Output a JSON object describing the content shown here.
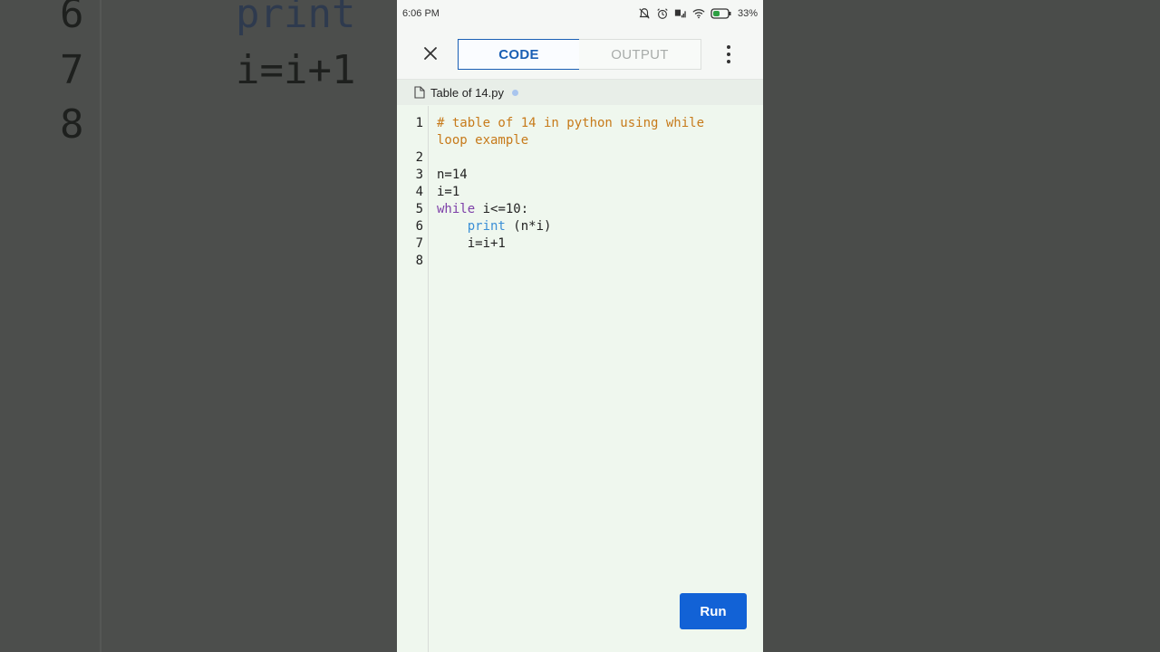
{
  "background": {
    "line_numbers": [
      "6",
      "7",
      "8"
    ],
    "code_lines": [
      "print",
      "i=i+1"
    ]
  },
  "status_bar": {
    "time": "6:06 PM",
    "battery": "33%"
  },
  "toolbar": {
    "code_tab": "CODE",
    "output_tab": "OUTPUT"
  },
  "file": {
    "name": "Table of 14.py"
  },
  "editor": {
    "line_numbers": [
      "1",
      "2",
      "3",
      "4",
      "5",
      "6",
      "7",
      "8"
    ],
    "lines": {
      "l1a": "# table of 14 in python using while",
      "l1b": "loop example",
      "l3": "n=14",
      "l4": "i=1",
      "l5_kw": "while",
      "l5_rest": " i<=10:",
      "l6_indent": "    ",
      "l6_fn": "print",
      "l6_rest": " (n*i)",
      "l7": "    i=i+1"
    }
  },
  "run_label": "Run",
  "colors": {
    "accent": "#1262d6",
    "comment": "#c77a1a",
    "keyword": "#7d3fa8",
    "builtin": "#3b8fd6"
  },
  "icons": [
    "close-icon",
    "more-vert-icon",
    "file-icon",
    "bell-off-icon",
    "alarm-icon",
    "signal-icon",
    "wifi-icon",
    "battery-icon"
  ]
}
